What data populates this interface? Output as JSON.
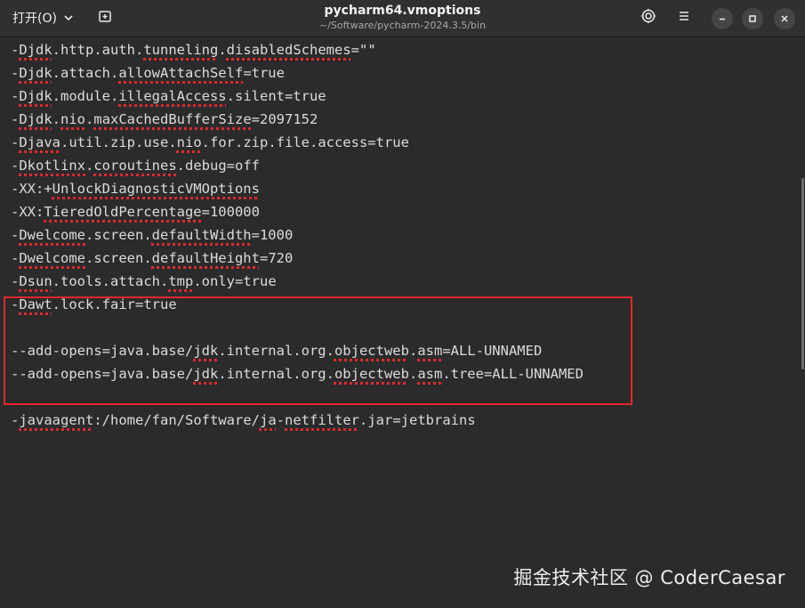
{
  "header": {
    "open_label": "打开(O)",
    "title": "pycharm64.vmoptions",
    "subtitle": "~/Software/pycharm-2024.3.5/bin"
  },
  "editor": {
    "lines": [
      {
        "segments": [
          {
            "t": "-"
          },
          {
            "t": "Djdk",
            "s": 1
          },
          {
            "t": ".http.auth."
          },
          {
            "t": "tunneling",
            "s": 1
          },
          {
            "t": "."
          },
          {
            "t": "disabledSchemes",
            "s": 1
          },
          {
            "t": "=\"\""
          }
        ]
      },
      {
        "segments": [
          {
            "t": "-"
          },
          {
            "t": "Djdk",
            "s": 1
          },
          {
            "t": ".attach."
          },
          {
            "t": "allowAttachSelf",
            "s": 1
          },
          {
            "t": "=true"
          }
        ]
      },
      {
        "segments": [
          {
            "t": "-"
          },
          {
            "t": "Djdk",
            "s": 1
          },
          {
            "t": ".module."
          },
          {
            "t": "illegalAccess",
            "s": 1
          },
          {
            "t": ".silent=true"
          }
        ]
      },
      {
        "segments": [
          {
            "t": "-"
          },
          {
            "t": "Djdk",
            "s": 1
          },
          {
            "t": "."
          },
          {
            "t": "nio",
            "s": 1
          },
          {
            "t": "."
          },
          {
            "t": "maxCachedBufferSize",
            "s": 1
          },
          {
            "t": "=2097152"
          }
        ]
      },
      {
        "segments": [
          {
            "t": "-"
          },
          {
            "t": "Djava",
            "s": 1
          },
          {
            "t": ".util.zip.use."
          },
          {
            "t": "nio",
            "s": 1
          },
          {
            "t": ".for.zip.file.access=true"
          }
        ]
      },
      {
        "segments": [
          {
            "t": "-"
          },
          {
            "t": "Dkotlinx",
            "s": 1
          },
          {
            "t": "."
          },
          {
            "t": "coroutines",
            "s": 1
          },
          {
            "t": ".debug=off"
          }
        ]
      },
      {
        "segments": [
          {
            "t": "-XX:+"
          },
          {
            "t": "UnlockDiagnosticVMOptions",
            "s": 1
          }
        ]
      },
      {
        "segments": [
          {
            "t": "-XX:"
          },
          {
            "t": "TieredOldPercentage",
            "s": 1
          },
          {
            "t": "=100000"
          }
        ]
      },
      {
        "segments": [
          {
            "t": "-"
          },
          {
            "t": "Dwelcome",
            "s": 1
          },
          {
            "t": ".screen."
          },
          {
            "t": "defaultWidth",
            "s": 1
          },
          {
            "t": "=1000"
          }
        ]
      },
      {
        "segments": [
          {
            "t": "-"
          },
          {
            "t": "Dwelcome",
            "s": 1
          },
          {
            "t": ".screen."
          },
          {
            "t": "defaultHeight",
            "s": 1
          },
          {
            "t": "=720"
          }
        ]
      },
      {
        "segments": [
          {
            "t": "-"
          },
          {
            "t": "Dsun",
            "s": 1
          },
          {
            "t": ".tools.attach."
          },
          {
            "t": "tmp",
            "s": 1
          },
          {
            "t": ".only=true"
          }
        ]
      },
      {
        "segments": [
          {
            "t": "-"
          },
          {
            "t": "Dawt",
            "s": 1
          },
          {
            "t": ".lock.fair=true"
          }
        ]
      },
      {
        "segments": []
      },
      {
        "segments": [
          {
            "t": "--add-opens=java.base/"
          },
          {
            "t": "jdk",
            "s": 1
          },
          {
            "t": ".internal.org."
          },
          {
            "t": "objectweb",
            "s": 1
          },
          {
            "t": "."
          },
          {
            "t": "asm",
            "s": 1
          },
          {
            "t": "=ALL-UNNAMED"
          }
        ]
      },
      {
        "segments": [
          {
            "t": "--add-opens=java.base/"
          },
          {
            "t": "jdk",
            "s": 1
          },
          {
            "t": ".internal.org."
          },
          {
            "t": "objectweb",
            "s": 1
          },
          {
            "t": "."
          },
          {
            "t": "asm",
            "s": 1
          },
          {
            "t": ".tree=ALL-UNNAMED"
          }
        ]
      },
      {
        "segments": []
      },
      {
        "segments": [
          {
            "t": "-"
          },
          {
            "t": "javaagent",
            "s": 1
          },
          {
            "t": ":/home/fan/Software/"
          },
          {
            "t": "ja",
            "s": 1
          },
          {
            "t": "-"
          },
          {
            "t": "netfilter",
            "s": 1
          },
          {
            "t": ".jar=jetbrains"
          }
        ]
      }
    ]
  },
  "watermark": "掘金技术社区 @ CoderCaesar",
  "colors": {
    "background": "#2b2b2b",
    "header": "#303030",
    "spell_underline": "#e0282e",
    "highlight_border": "#e0282e"
  },
  "icons": {
    "open_dropdown": "chevron-down-icon",
    "new_tab": "new-tab-icon",
    "spellcheck": "spellcheck-icon",
    "menu": "hamburger-menu-icon",
    "minimize": "minimize-icon",
    "maximize": "maximize-icon",
    "close": "close-icon"
  }
}
